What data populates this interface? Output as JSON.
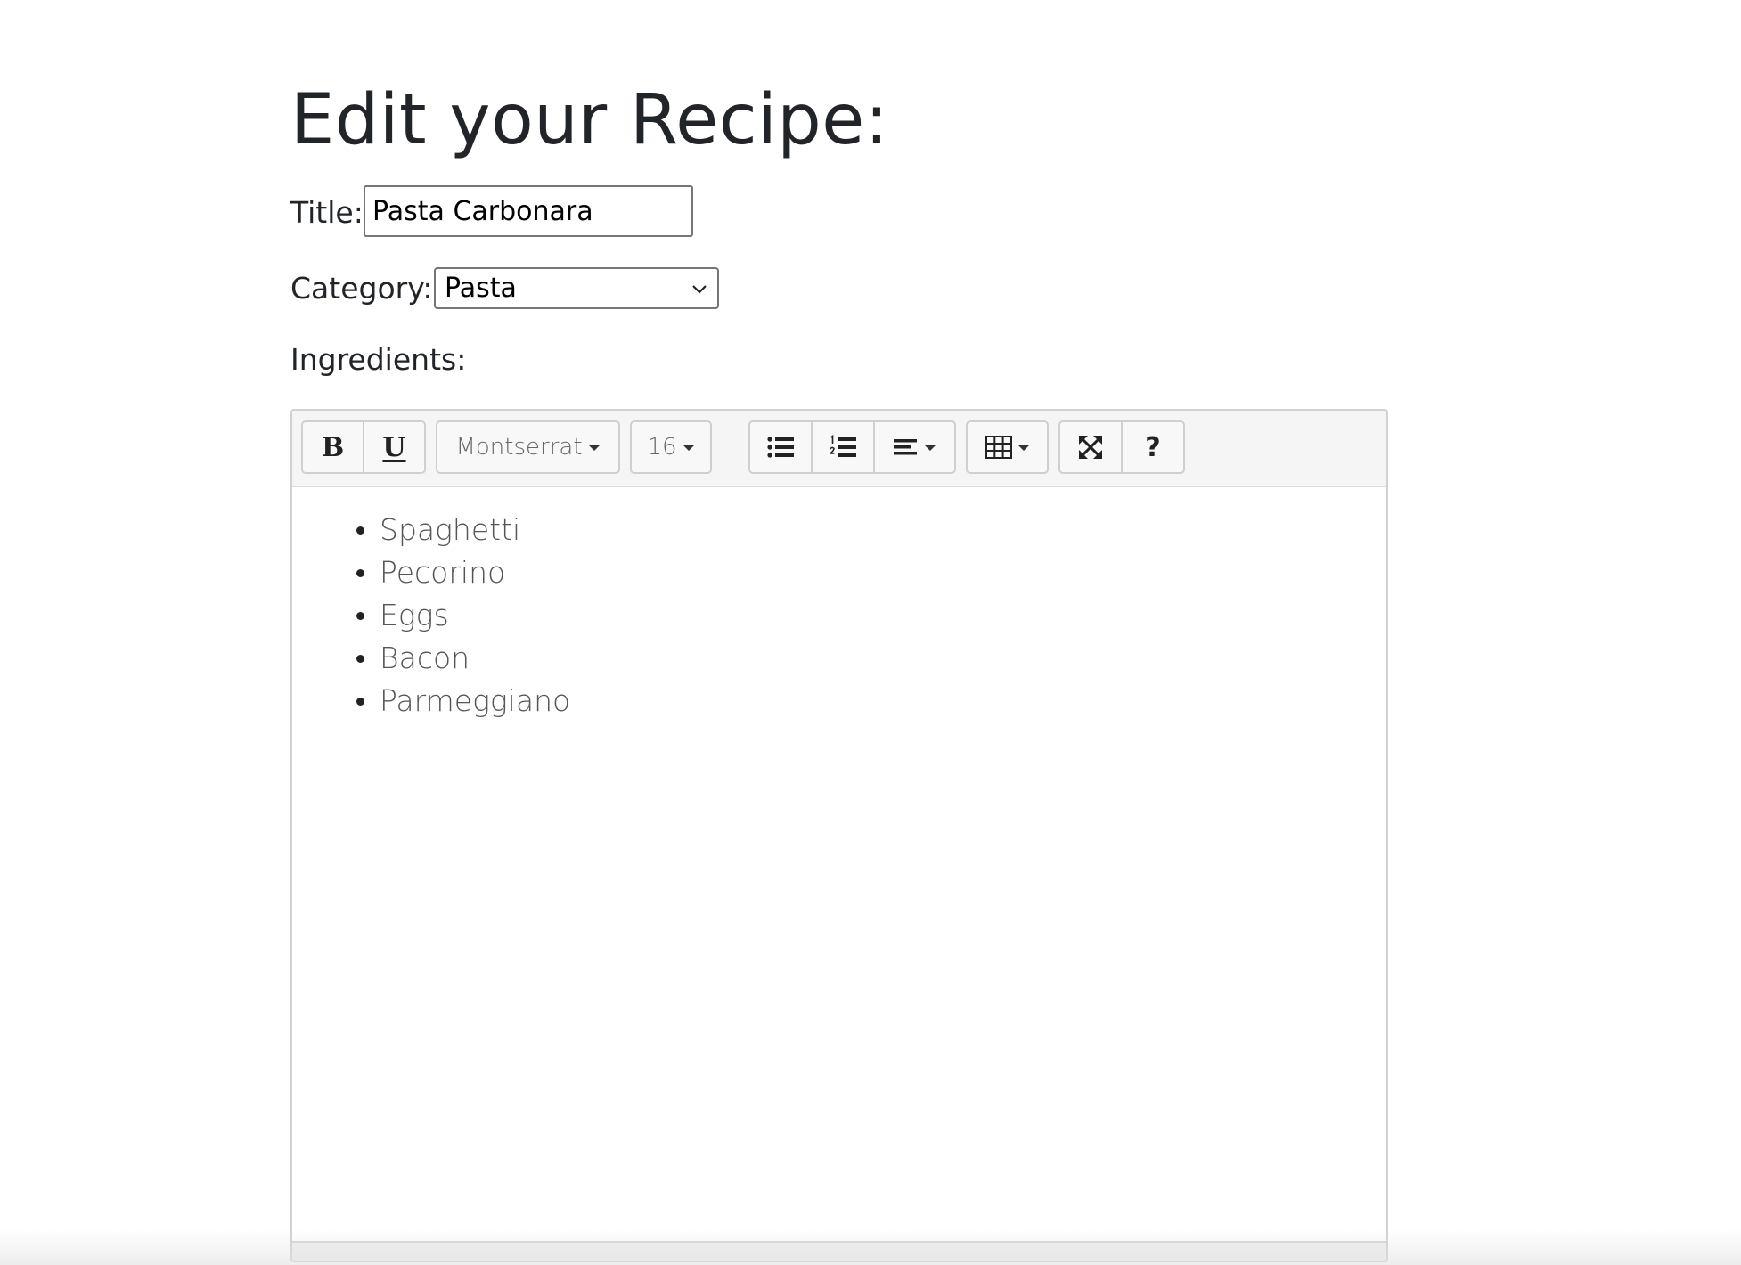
{
  "page": {
    "title": "Edit your Recipe:"
  },
  "form": {
    "title_label": "Title:",
    "title_value": "Pasta Carbonara",
    "category_label": "Category:",
    "category_value": "Pasta",
    "ingredients_label": "Ingredients:"
  },
  "editor": {
    "toolbar": {
      "bold": "B",
      "underline": "U",
      "font_family": "Montserrat",
      "font_size": "16",
      "help": "?"
    },
    "icons": [
      "bold-icon",
      "underline-icon",
      "unordered-list-icon",
      "ordered-list-icon",
      "align-icon",
      "table-icon",
      "fullscreen-icon",
      "help-icon"
    ],
    "ingredients": [
      "Spaghetti",
      "Pecorino",
      "Eggs",
      "Bacon",
      "Parmeggiano"
    ]
  }
}
